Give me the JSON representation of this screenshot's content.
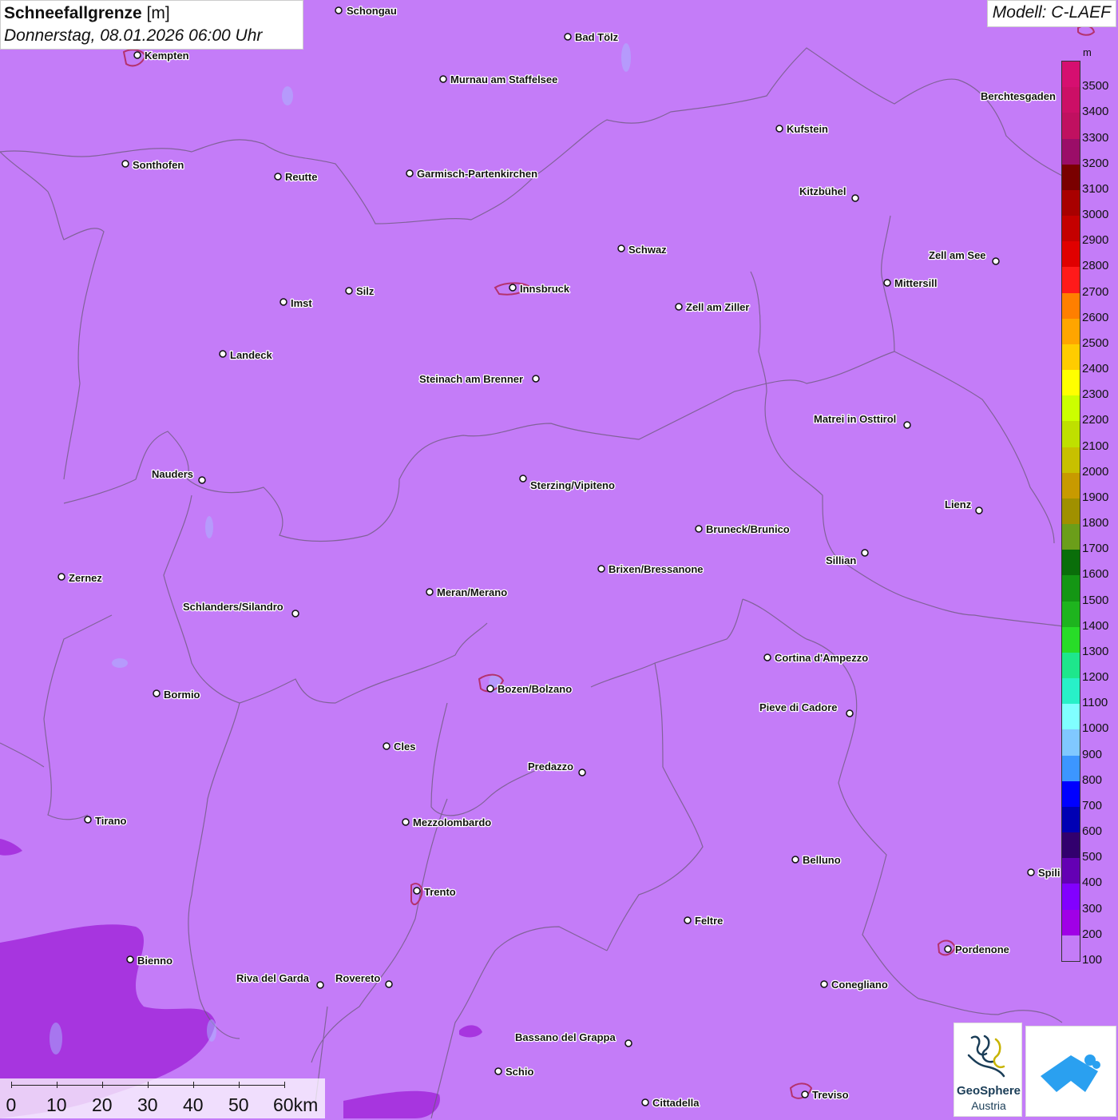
{
  "header": {
    "title_bold": "Schneefallgrenze",
    "title_unit": "[m]",
    "datetime": "Donnerstag, 08.01.2026 06:00 Uhr"
  },
  "model_label": "Modell: C-LAEF",
  "legend": {
    "unit": "m",
    "steps": [
      {
        "label": "3500",
        "color": "#d60f70"
      },
      {
        "label": "3400",
        "color": "#cc0f66"
      },
      {
        "label": "3300",
        "color": "#c01060"
      },
      {
        "label": "3200",
        "color": "#9b0d68"
      },
      {
        "label": "3100",
        "color": "#7a0000"
      },
      {
        "label": "3000",
        "color": "#a80000"
      },
      {
        "label": "2900",
        "color": "#c40000"
      },
      {
        "label": "2800",
        "color": "#e00000"
      },
      {
        "label": "2700",
        "color": "#ff1a1a"
      },
      {
        "label": "2600",
        "color": "#ff7f00"
      },
      {
        "label": "2500",
        "color": "#ffa500"
      },
      {
        "label": "2400",
        "color": "#ffcc00"
      },
      {
        "label": "2300",
        "color": "#ffff00"
      },
      {
        "label": "2200",
        "color": "#ccff00"
      },
      {
        "label": "2100",
        "color": "#bfe000"
      },
      {
        "label": "2000",
        "color": "#c8c000"
      },
      {
        "label": "1900",
        "color": "#c89a00"
      },
      {
        "label": "1800",
        "color": "#a09000"
      },
      {
        "label": "1700",
        "color": "#6b9e1a"
      },
      {
        "label": "1600",
        "color": "#0a6e0a"
      },
      {
        "label": "1500",
        "color": "#149614"
      },
      {
        "label": "1400",
        "color": "#1eb41e"
      },
      {
        "label": "1300",
        "color": "#28dc28"
      },
      {
        "label": "1200",
        "color": "#1ee68c"
      },
      {
        "label": "1100",
        "color": "#28f0c8"
      },
      {
        "label": "1000",
        "color": "#80ffff"
      },
      {
        "label": "900",
        "color": "#80c8ff"
      },
      {
        "label": "800",
        "color": "#3c96ff"
      },
      {
        "label": "700",
        "color": "#0000ff"
      },
      {
        "label": "600",
        "color": "#0000b4"
      },
      {
        "label": "500",
        "color": "#32006e"
      },
      {
        "label": "400",
        "color": "#6400b4"
      },
      {
        "label": "300",
        "color": "#8200ff"
      },
      {
        "label": "200",
        "color": "#a000e6"
      },
      {
        "label": "100",
        "color": "#c47cf8"
      }
    ]
  },
  "scale_bar": {
    "labels": [
      "0",
      "10",
      "20",
      "30",
      "40",
      "50",
      "60km"
    ]
  },
  "logo": {
    "line1": "GeoSphere",
    "line2": "Austria"
  },
  "cities": [
    {
      "name": "Schongau"
    },
    {
      "name": "Bad Tölz"
    },
    {
      "name": "Kempten"
    },
    {
      "name": "Murnau am Staffelsee"
    },
    {
      "name": "Berchtesgaden"
    },
    {
      "name": "Kufstein"
    },
    {
      "name": "Sonthofen"
    },
    {
      "name": "Reutte"
    },
    {
      "name": "Garmisch-Partenkirchen"
    },
    {
      "name": "Kitzbühel"
    },
    {
      "name": "Schwaz"
    },
    {
      "name": "Zell am See"
    },
    {
      "name": "Innsbruck"
    },
    {
      "name": "Mittersill"
    },
    {
      "name": "Silz"
    },
    {
      "name": "Imst"
    },
    {
      "name": "Zell am Ziller"
    },
    {
      "name": "Landeck"
    },
    {
      "name": "Steinach am Brenner"
    },
    {
      "name": "Matrei in Osttirol"
    },
    {
      "name": "Nauders"
    },
    {
      "name": "Sterzing/Vipiteno"
    },
    {
      "name": "Lienz"
    },
    {
      "name": "Bruneck/Brunico"
    },
    {
      "name": "Sillian"
    },
    {
      "name": "Zernez"
    },
    {
      "name": "Brixen/Bressanone"
    },
    {
      "name": "Meran/Merano"
    },
    {
      "name": "Schlanders/Silandro"
    },
    {
      "name": "Cortina d'Ampezzo"
    },
    {
      "name": "Bozen/Bolzano"
    },
    {
      "name": "Bormio"
    },
    {
      "name": "Pieve di Cadore"
    },
    {
      "name": "Cles"
    },
    {
      "name": "Predazzo"
    },
    {
      "name": "Tirano"
    },
    {
      "name": "Mezzolombardo"
    },
    {
      "name": "Belluno"
    },
    {
      "name": "Spili"
    },
    {
      "name": "Trento"
    },
    {
      "name": "Feltre"
    },
    {
      "name": "Pordenone"
    },
    {
      "name": "Bienno"
    },
    {
      "name": "Riva del Garda"
    },
    {
      "name": "Rovereto"
    },
    {
      "name": "Conegliano"
    },
    {
      "name": "Bassano del Grappa"
    },
    {
      "name": "Schio"
    },
    {
      "name": "Treviso"
    },
    {
      "name": "Cittadella"
    }
  ]
}
